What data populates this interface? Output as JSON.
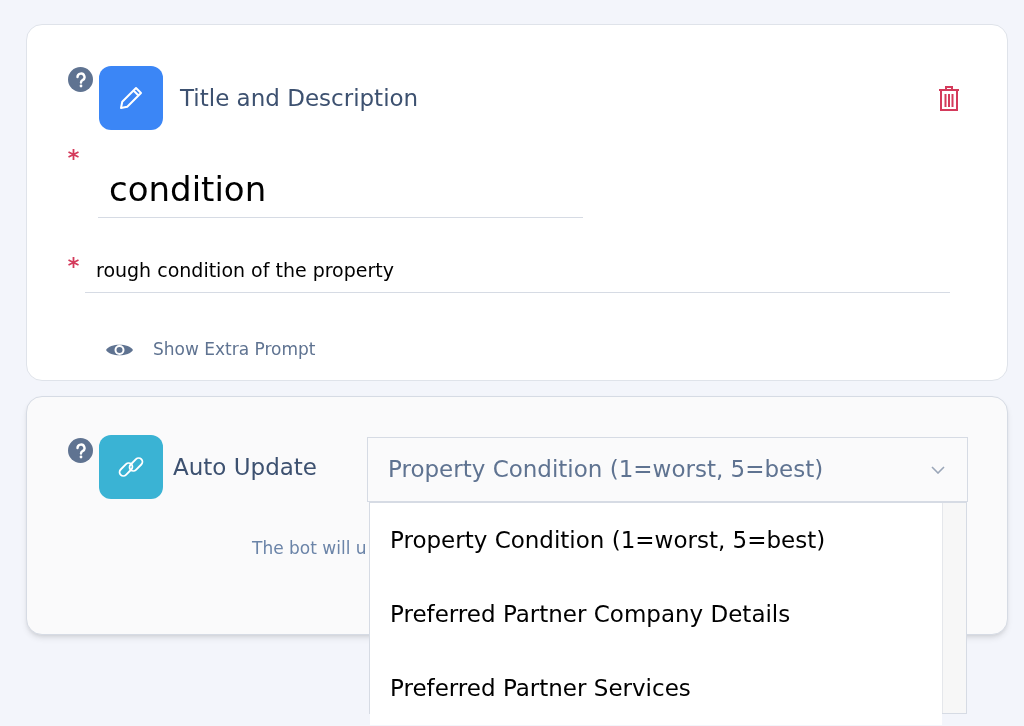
{
  "title_card": {
    "title": "Title and Description",
    "name_field": {
      "value": "condition",
      "required": true
    },
    "description_field": {
      "value": "rough condition of the property",
      "required": true
    },
    "extra_prompt_link": "Show Extra Prompt"
  },
  "auto_update_card": {
    "title": "Auto Update",
    "hint": "The bot will u",
    "select": {
      "value": "Property Condition (1=worst, 5=best)",
      "expanded": true
    },
    "options": [
      {
        "label": "Property Condition (1=worst, 5=best)",
        "selected": false
      },
      {
        "label": "Preferred Partner Company Details",
        "selected": false
      },
      {
        "label": "Preferred Partner Services",
        "selected": false
      }
    ]
  }
}
